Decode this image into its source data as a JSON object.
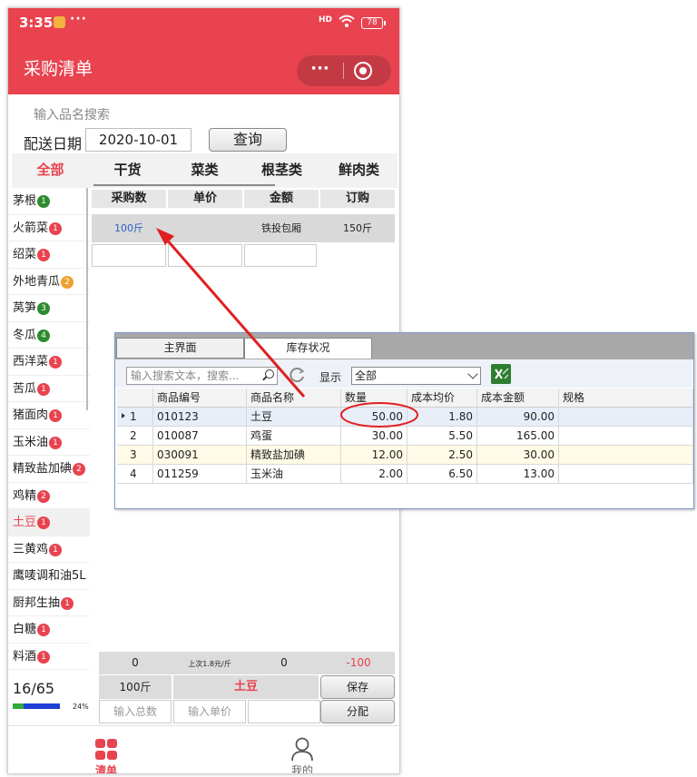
{
  "status": {
    "time": "3:35",
    "more": "···",
    "signal": "HD",
    "battery": "78"
  },
  "header": {
    "title": "采购清单",
    "capsule_more": "···"
  },
  "search": {
    "hint": "输入品名搜索"
  },
  "date": {
    "label": "配送日期",
    "value": "2020-10-01",
    "query_label": "查询"
  },
  "categories": [
    {
      "label": "全部",
      "active": true
    },
    {
      "label": "干货",
      "active": false
    },
    {
      "label": "菜类",
      "active": false
    },
    {
      "label": "根茎类",
      "active": false
    },
    {
      "label": "鲜肉类",
      "active": false
    }
  ],
  "items": [
    {
      "name": "茅根",
      "badge": "1",
      "color": "green"
    },
    {
      "name": "火箭菜",
      "badge": "1",
      "color": "red"
    },
    {
      "name": "绍菜",
      "badge": "1",
      "color": "red"
    },
    {
      "name": "外地青瓜",
      "badge": "2",
      "color": "orange"
    },
    {
      "name": "莴笋",
      "badge": "3",
      "color": "green"
    },
    {
      "name": "冬瓜",
      "badge": "4",
      "color": "green"
    },
    {
      "name": "西洋菜",
      "badge": "1",
      "color": "red"
    },
    {
      "name": "苦瓜",
      "badge": "1",
      "color": "red"
    },
    {
      "name": "猪面肉",
      "badge": "1",
      "color": "red"
    },
    {
      "name": "玉米油",
      "badge": "1",
      "color": "red"
    },
    {
      "name": "精致盐加碘",
      "badge": "2",
      "color": "red"
    },
    {
      "name": "鸡精",
      "badge": "2",
      "color": "red"
    },
    {
      "name": "土豆",
      "badge": "1",
      "color": "red",
      "selected": true
    },
    {
      "name": "三黄鸡",
      "badge": "1",
      "color": "red"
    },
    {
      "name": "鹰唛调和油5L",
      "badge": "",
      "color": "red"
    },
    {
      "name": "厨邦生抽",
      "badge": "1",
      "color": "red"
    },
    {
      "name": "白糖",
      "badge": "1",
      "color": "red"
    },
    {
      "name": "料酒",
      "badge": "1",
      "color": "red"
    }
  ],
  "order": {
    "headers": [
      "采购数",
      "单价",
      "金额",
      "订购"
    ],
    "row": {
      "qty": "100斤",
      "price": "",
      "amount": "铁投包厢",
      "order": "150斤"
    }
  },
  "bottom": {
    "row1": {
      "a": "0",
      "last_price": "上次1.8元/斤",
      "b": "0",
      "diff": "-100"
    },
    "row2": {
      "qty": "100斤",
      "name": "土豆",
      "save": "保存"
    },
    "row3": {
      "total_placeholder": "输入总数",
      "price_placeholder": "输入单价",
      "assign": "分配"
    },
    "progress": {
      "count": "16/65",
      "percent": "24%",
      "fraction": 0.24
    }
  },
  "tabbar": {
    "list": "清单",
    "me": "我的"
  },
  "inventory": {
    "tabs": [
      "主界面",
      "库存状况"
    ],
    "search_placeholder": "输入搜索文本，搜索...",
    "show_label": "显示",
    "show_value": "全部",
    "columns": [
      "",
      "商品编号",
      "商品名称",
      "数量",
      "成本均价",
      "成本金额",
      "规格"
    ],
    "rows": [
      {
        "idx": "1",
        "code": "010123",
        "name": "土豆",
        "qty": "50.00",
        "cost": "1.80",
        "amount": "90.00"
      },
      {
        "idx": "2",
        "code": "010087",
        "name": "鸡蛋",
        "qty": "30.00",
        "cost": "5.50",
        "amount": "165.00"
      },
      {
        "idx": "3",
        "code": "030091",
        "name": "精致盐加碘",
        "qty": "12.00",
        "cost": "2.50",
        "amount": "30.00"
      },
      {
        "idx": "4",
        "code": "011259",
        "name": "玉米油",
        "qty": "2.00",
        "cost": "6.50",
        "amount": "13.00"
      }
    ]
  },
  "colors": {
    "brand_red": "#e8434f",
    "annotation_red": "#e02020"
  }
}
